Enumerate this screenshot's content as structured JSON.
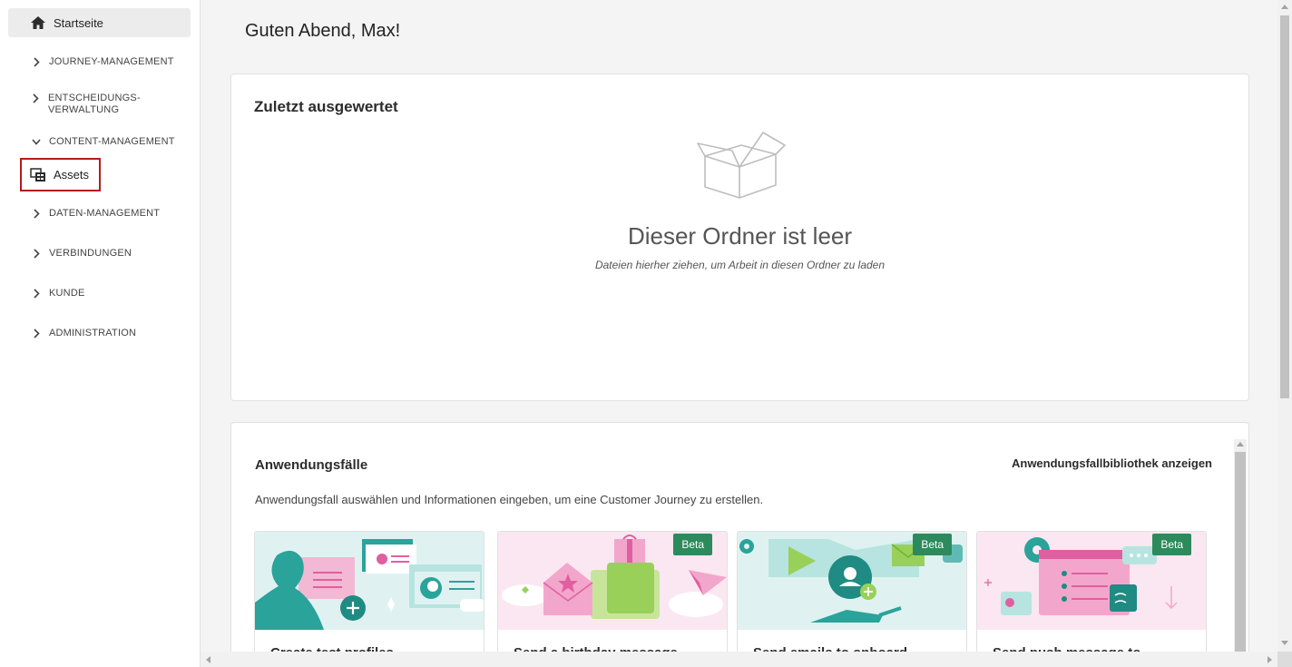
{
  "sidebar": {
    "home_label": "Startseite",
    "items": [
      {
        "label": "JOURNEY-MANAGEMENT",
        "expanded": false
      },
      {
        "label": "ENTSCHEIDUNGS-\nVERWALTUNG",
        "expanded": false
      },
      {
        "label": "CONTENT-MANAGEMENT",
        "expanded": true
      },
      {
        "label": "DATEN-MANAGEMENT",
        "expanded": false
      },
      {
        "label": "VERBINDUNGEN",
        "expanded": false
      },
      {
        "label": "KUNDE",
        "expanded": false
      },
      {
        "label": "ADMINISTRATION",
        "expanded": false
      }
    ],
    "assets_label": "Assets"
  },
  "main": {
    "greeting": "Guten Abend, Max!",
    "recent": {
      "title": "Zuletzt ausgewertet",
      "empty_title": "Dieser Ordner ist leer",
      "empty_subtitle": "Dateien hierher ziehen, um Arbeit in diesen Ordner zu laden"
    },
    "usecases": {
      "title": "Anwendungsfälle",
      "library_link": "Anwendungsfallbibliothek anzeigen",
      "description": "Anwendungsfall auswählen und Informationen eingeben, um eine Customer Journey zu erstellen.",
      "tiles": [
        {
          "label": "Create test profiles",
          "beta": ""
        },
        {
          "label": "Send a birthday message",
          "beta": "Beta"
        },
        {
          "label": "Send emails to onboard",
          "beta": "Beta"
        },
        {
          "label": "Send push message to",
          "beta": "Beta"
        }
      ]
    }
  },
  "colors": {
    "accent_red": "#b31b1b",
    "beta_green": "#2d8a5c",
    "teal": "#2aa39a",
    "pink": "#e05fa0"
  }
}
